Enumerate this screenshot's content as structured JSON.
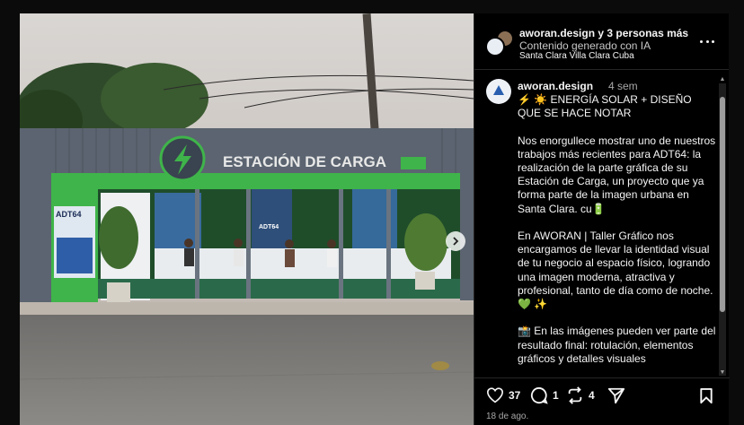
{
  "header": {
    "username": "aworan.design",
    "collab_text": "y 3 personas más",
    "subtitle": "Contenido generado con IA",
    "location": "Santa Clara Villa Clara Cuba"
  },
  "photo": {
    "sign_text": "ESTACIÓN DE CARGA",
    "side_panel_text": "ADT64",
    "center_panel_text": "ADT64"
  },
  "caption": {
    "username": "aworan.design",
    "time": "4 sem",
    "text": "⚡ ☀️ ENERGÍA SOLAR + DISEÑO QUE SE HACE NOTAR\n\nNos enorgullece mostrar uno de nuestros trabajos más recientes para ADT64: la realización de la parte gráfica de su Estación de Carga, un proyecto que ya forma parte de la imagen urbana en Santa Clara. cu🔋\n\nEn AWORAN | Taller Gráfico nos encargamos de llevar la identidad visual de tu negocio al espacio físico, logrando una imagen moderna, atractiva y profesional, tanto de día como de noche. 💚 ✨\n\n📸 En las imágenes pueden ver parte del resultado final: rotulación, elementos gráficos y detalles visuales"
  },
  "actions": {
    "likes": "37",
    "comments": "1",
    "reposts": "4"
  },
  "date": "18 de ago.",
  "colors": {
    "accent_green": "#3fb44a",
    "structure_gray": "#5b6470",
    "background": "#000000"
  }
}
